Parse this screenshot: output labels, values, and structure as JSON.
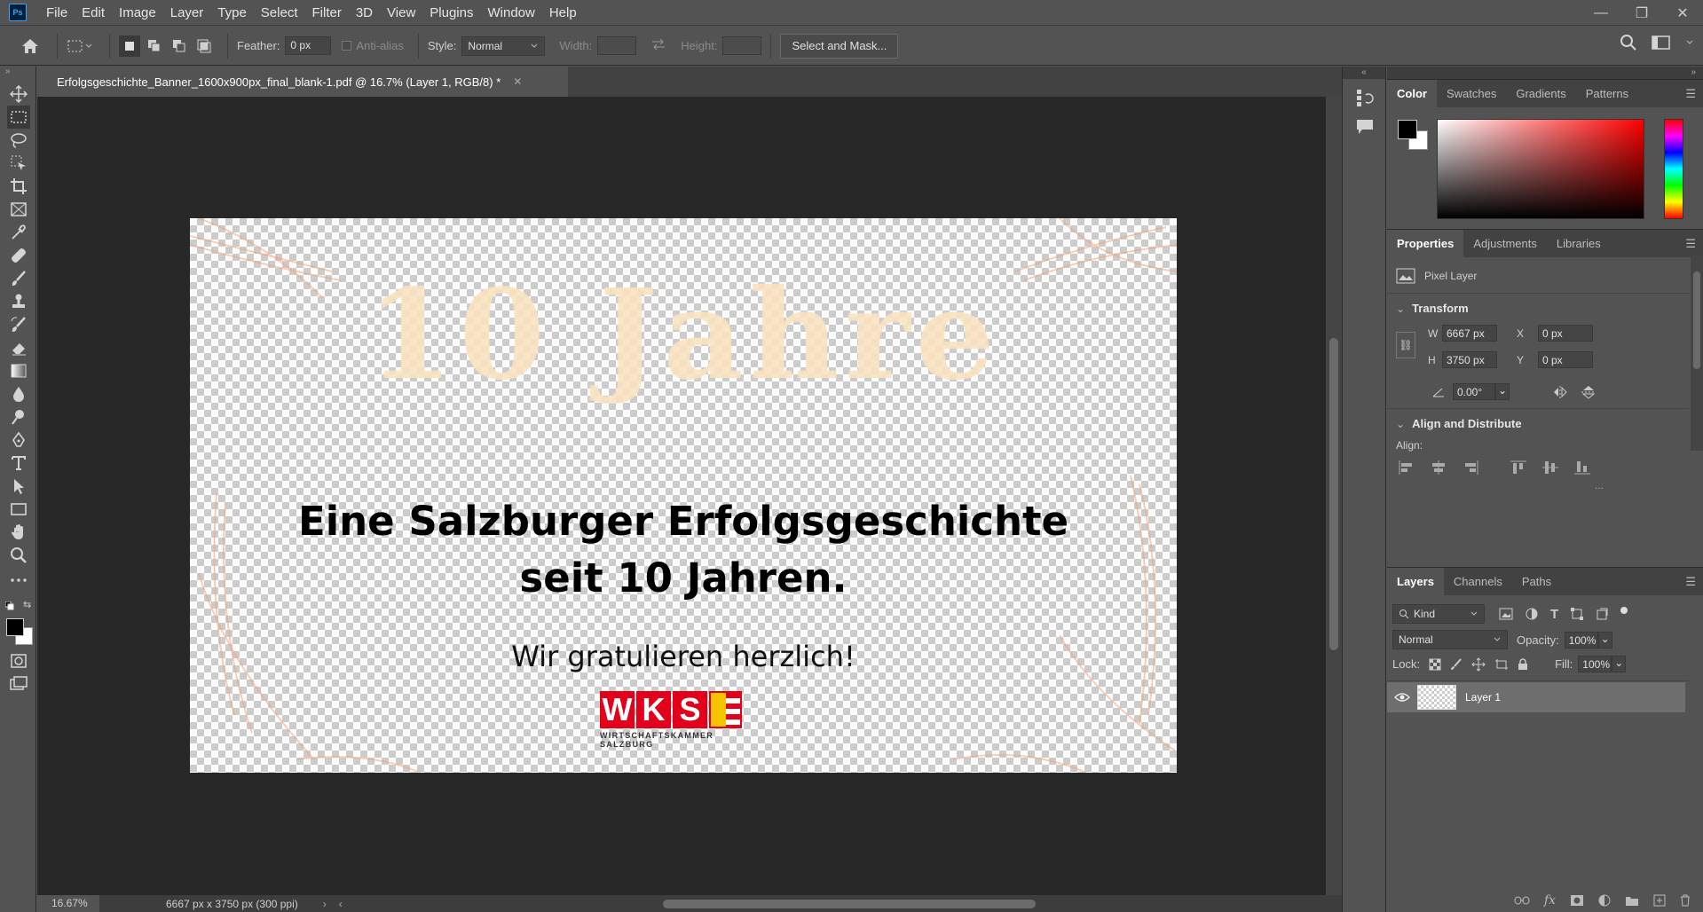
{
  "app": {
    "logo_text": "Ps"
  },
  "menu": {
    "items": [
      "File",
      "Edit",
      "Image",
      "Layer",
      "Type",
      "Select",
      "Filter",
      "3D",
      "View",
      "Plugins",
      "Window",
      "Help"
    ]
  },
  "window_controls": {
    "minimize": "—",
    "restore": "❐",
    "close": "✕"
  },
  "options": {
    "feather_label": "Feather:",
    "feather_value": "0 px",
    "antialias_label": "Anti-alias",
    "style_label": "Style:",
    "style_value": "Normal",
    "width_label": "Width:",
    "height_label": "Height:",
    "select_mask_label": "Select and Mask..."
  },
  "document": {
    "tab_title": "Erfolgsgeschichte_Banner_1600x900px_final_blank-1.pdf @ 16.7% (Layer 1, RGB/8) *",
    "big_title": "10 Jahre",
    "headline_1": "Eine Salzburger Erfolgsgeschichte",
    "headline_2": "seit 10 Jahren.",
    "subline": "Wir gratulieren herzlich!",
    "logo_letters": [
      "W",
      "K",
      "S"
    ],
    "logo_subtitle": "WIRTSCHAFTSKAMMER SALZBURG"
  },
  "status": {
    "zoom": "16.67%",
    "dimensions": "6667 px x 3750 px (300 ppi)"
  },
  "color_panel": {
    "tabs": [
      "Color",
      "Swatches",
      "Gradients",
      "Patterns"
    ],
    "active_tab": "Color"
  },
  "properties_panel": {
    "tabs": [
      "Properties",
      "Adjustments",
      "Libraries"
    ],
    "layer_type": "Pixel Layer",
    "transform_title": "Transform",
    "w_label": "W",
    "w_value": "6667 px",
    "h_label": "H",
    "h_value": "3750 px",
    "x_label": "X",
    "x_value": "0 px",
    "y_label": "Y",
    "y_value": "0 px",
    "angle_value": "0.00°",
    "align_title": "Align and Distribute",
    "align_label": "Align:",
    "more": "..."
  },
  "layers_panel": {
    "tabs": [
      "Layers",
      "Channels",
      "Paths"
    ],
    "filter_label": "Kind",
    "blend_mode": "Normal",
    "opacity_label": "Opacity:",
    "opacity_value": "100%",
    "lock_label": "Lock:",
    "fill_label": "Fill:",
    "fill_value": "100%",
    "layers": [
      {
        "name": "Layer 1",
        "visible": true
      }
    ]
  },
  "colors": {
    "accent_red": "#e2001a",
    "foreground": "#000000",
    "background": "#ffffff"
  }
}
